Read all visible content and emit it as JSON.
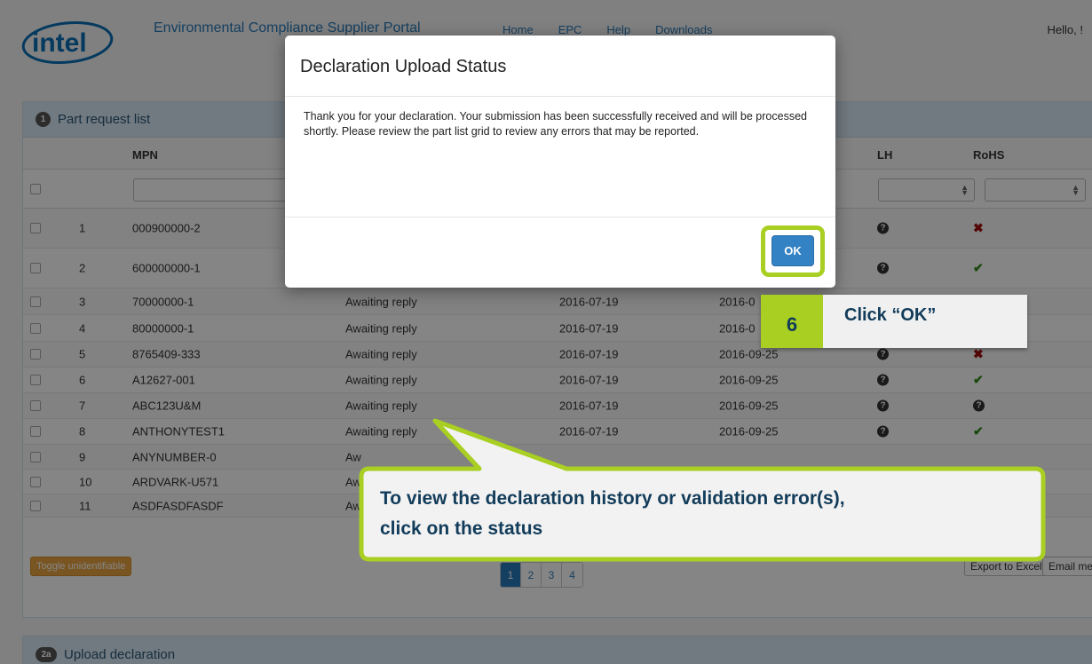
{
  "header": {
    "portal_title": "Environmental Compliance Supplier Portal",
    "nav": [
      "Home",
      "EPC",
      "Help",
      "Downloads"
    ],
    "greeting": "Hello, !"
  },
  "part_list": {
    "step": "1",
    "title": "Part request list",
    "columns": {
      "mpn": "MPN",
      "lh": "LH",
      "rohs": "RoHS"
    },
    "rows": [
      {
        "n": "1",
        "mpn": "000900000-2",
        "status": "",
        "d1": "",
        "d2": "",
        "lh": "question-icon",
        "rohs": "x-icon"
      },
      {
        "n": "2",
        "mpn": "600000000-1",
        "status": "",
        "d1": "",
        "d2": "",
        "lh": "question-icon",
        "rohs": "check-icon"
      },
      {
        "n": "3",
        "mpn": "70000000-1",
        "status": "Awaiting reply",
        "d1": "2016-07-19",
        "d2": "2016-0",
        "lh": "",
        "rohs": ""
      },
      {
        "n": "4",
        "mpn": "80000000-1",
        "status": "Awaiting reply",
        "d1": "2016-07-19",
        "d2": "2016-0",
        "lh": "",
        "rohs": ""
      },
      {
        "n": "5",
        "mpn": "8765409-333",
        "status": "Awaiting reply",
        "d1": "2016-07-19",
        "d2": "2016-09-25",
        "lh": "question-icon",
        "rohs": "x-icon"
      },
      {
        "n": "6",
        "mpn": "A12627-001",
        "status": "Awaiting reply",
        "d1": "2016-07-19",
        "d2": "2016-09-25",
        "lh": "question-icon",
        "rohs": "check-icon"
      },
      {
        "n": "7",
        "mpn": "ABC123U&M",
        "status": "Awaiting reply",
        "d1": "2016-07-19",
        "d2": "2016-09-25",
        "lh": "question-icon",
        "rohs": "question-icon"
      },
      {
        "n": "8",
        "mpn": "ANTHONYTEST1",
        "status": "Awaiting reply",
        "d1": "2016-07-19",
        "d2": "2016-09-25",
        "lh": "question-icon",
        "rohs": "check-icon"
      },
      {
        "n": "9",
        "mpn": "ANYNUMBER-0",
        "status": "Aw",
        "d1": "",
        "d2": "",
        "lh": "",
        "rohs": ""
      },
      {
        "n": "10",
        "mpn": "ARDVARK-U571",
        "status": "Aw",
        "d1": "",
        "d2": "",
        "lh": "",
        "rohs": ""
      },
      {
        "n": "11",
        "mpn": "ASDFASDFASDF",
        "status": "Aw",
        "d1": "",
        "d2": "",
        "lh": "",
        "rohs": ""
      }
    ],
    "toggle_label": "Toggle unidentifiable",
    "pages": [
      "1",
      "2",
      "3",
      "4"
    ],
    "export_label": "Export to Excel",
    "email_label": "Email me"
  },
  "upload": {
    "step": "2a",
    "title": "Upload declaration"
  },
  "modal": {
    "title": "Declaration Upload Status",
    "body": "Thank you for your declaration. Your submission has been successfully received and will be processed shortly. Please review the part list grid to review any errors that may be reported.",
    "ok_label": "OK"
  },
  "tutorial": {
    "step_number": "6",
    "step_text": "Click “OK”",
    "bubble_line1": "To view the declaration history or validation error(s),",
    "bubble_line2": "click on the status"
  },
  "colors": {
    "accent": "#2a7ab8",
    "highlight": "#a8cf22",
    "callout_text": "#123c5a"
  }
}
